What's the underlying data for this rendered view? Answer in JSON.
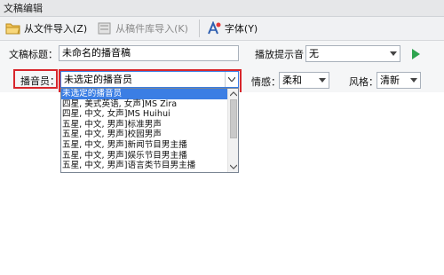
{
  "window": {
    "title": "文稿编辑"
  },
  "toolbar": {
    "import_file": "从文件导入(Z)",
    "import_template": "从稿件库导入(K)",
    "font": "字体(Y)"
  },
  "form": {
    "title_label": "文稿标题：",
    "title_value": "未命名的播音稿",
    "bg_music_label": "播放提示音：",
    "bg_music_value": "无",
    "announcer_label": "播音员：",
    "announcer_value": "未选定的播音员",
    "emotion_label": "情感：",
    "emotion_value": "柔和",
    "style_label": "风格：",
    "style_value": "清新"
  },
  "dropdown": {
    "items": [
      "未选定的播音员",
      "四星, 美式英语, 女声]MS Zira",
      "四星, 中文, 女声]MS Huihui",
      "五星, 中文, 男声]标准男声",
      "五星, 中文, 男声]校园男声",
      "五星, 中文, 男声]新闻节目男主播",
      "五星, 中文, 男声]娱乐节目男主播",
      "五星, 中文, 男声]语言类节目男主播"
    ],
    "selected_index": 0
  },
  "colors": {
    "highlight_border": "#d8262c",
    "selection": "#3b7ee4",
    "play_green": "#2ea44f"
  }
}
